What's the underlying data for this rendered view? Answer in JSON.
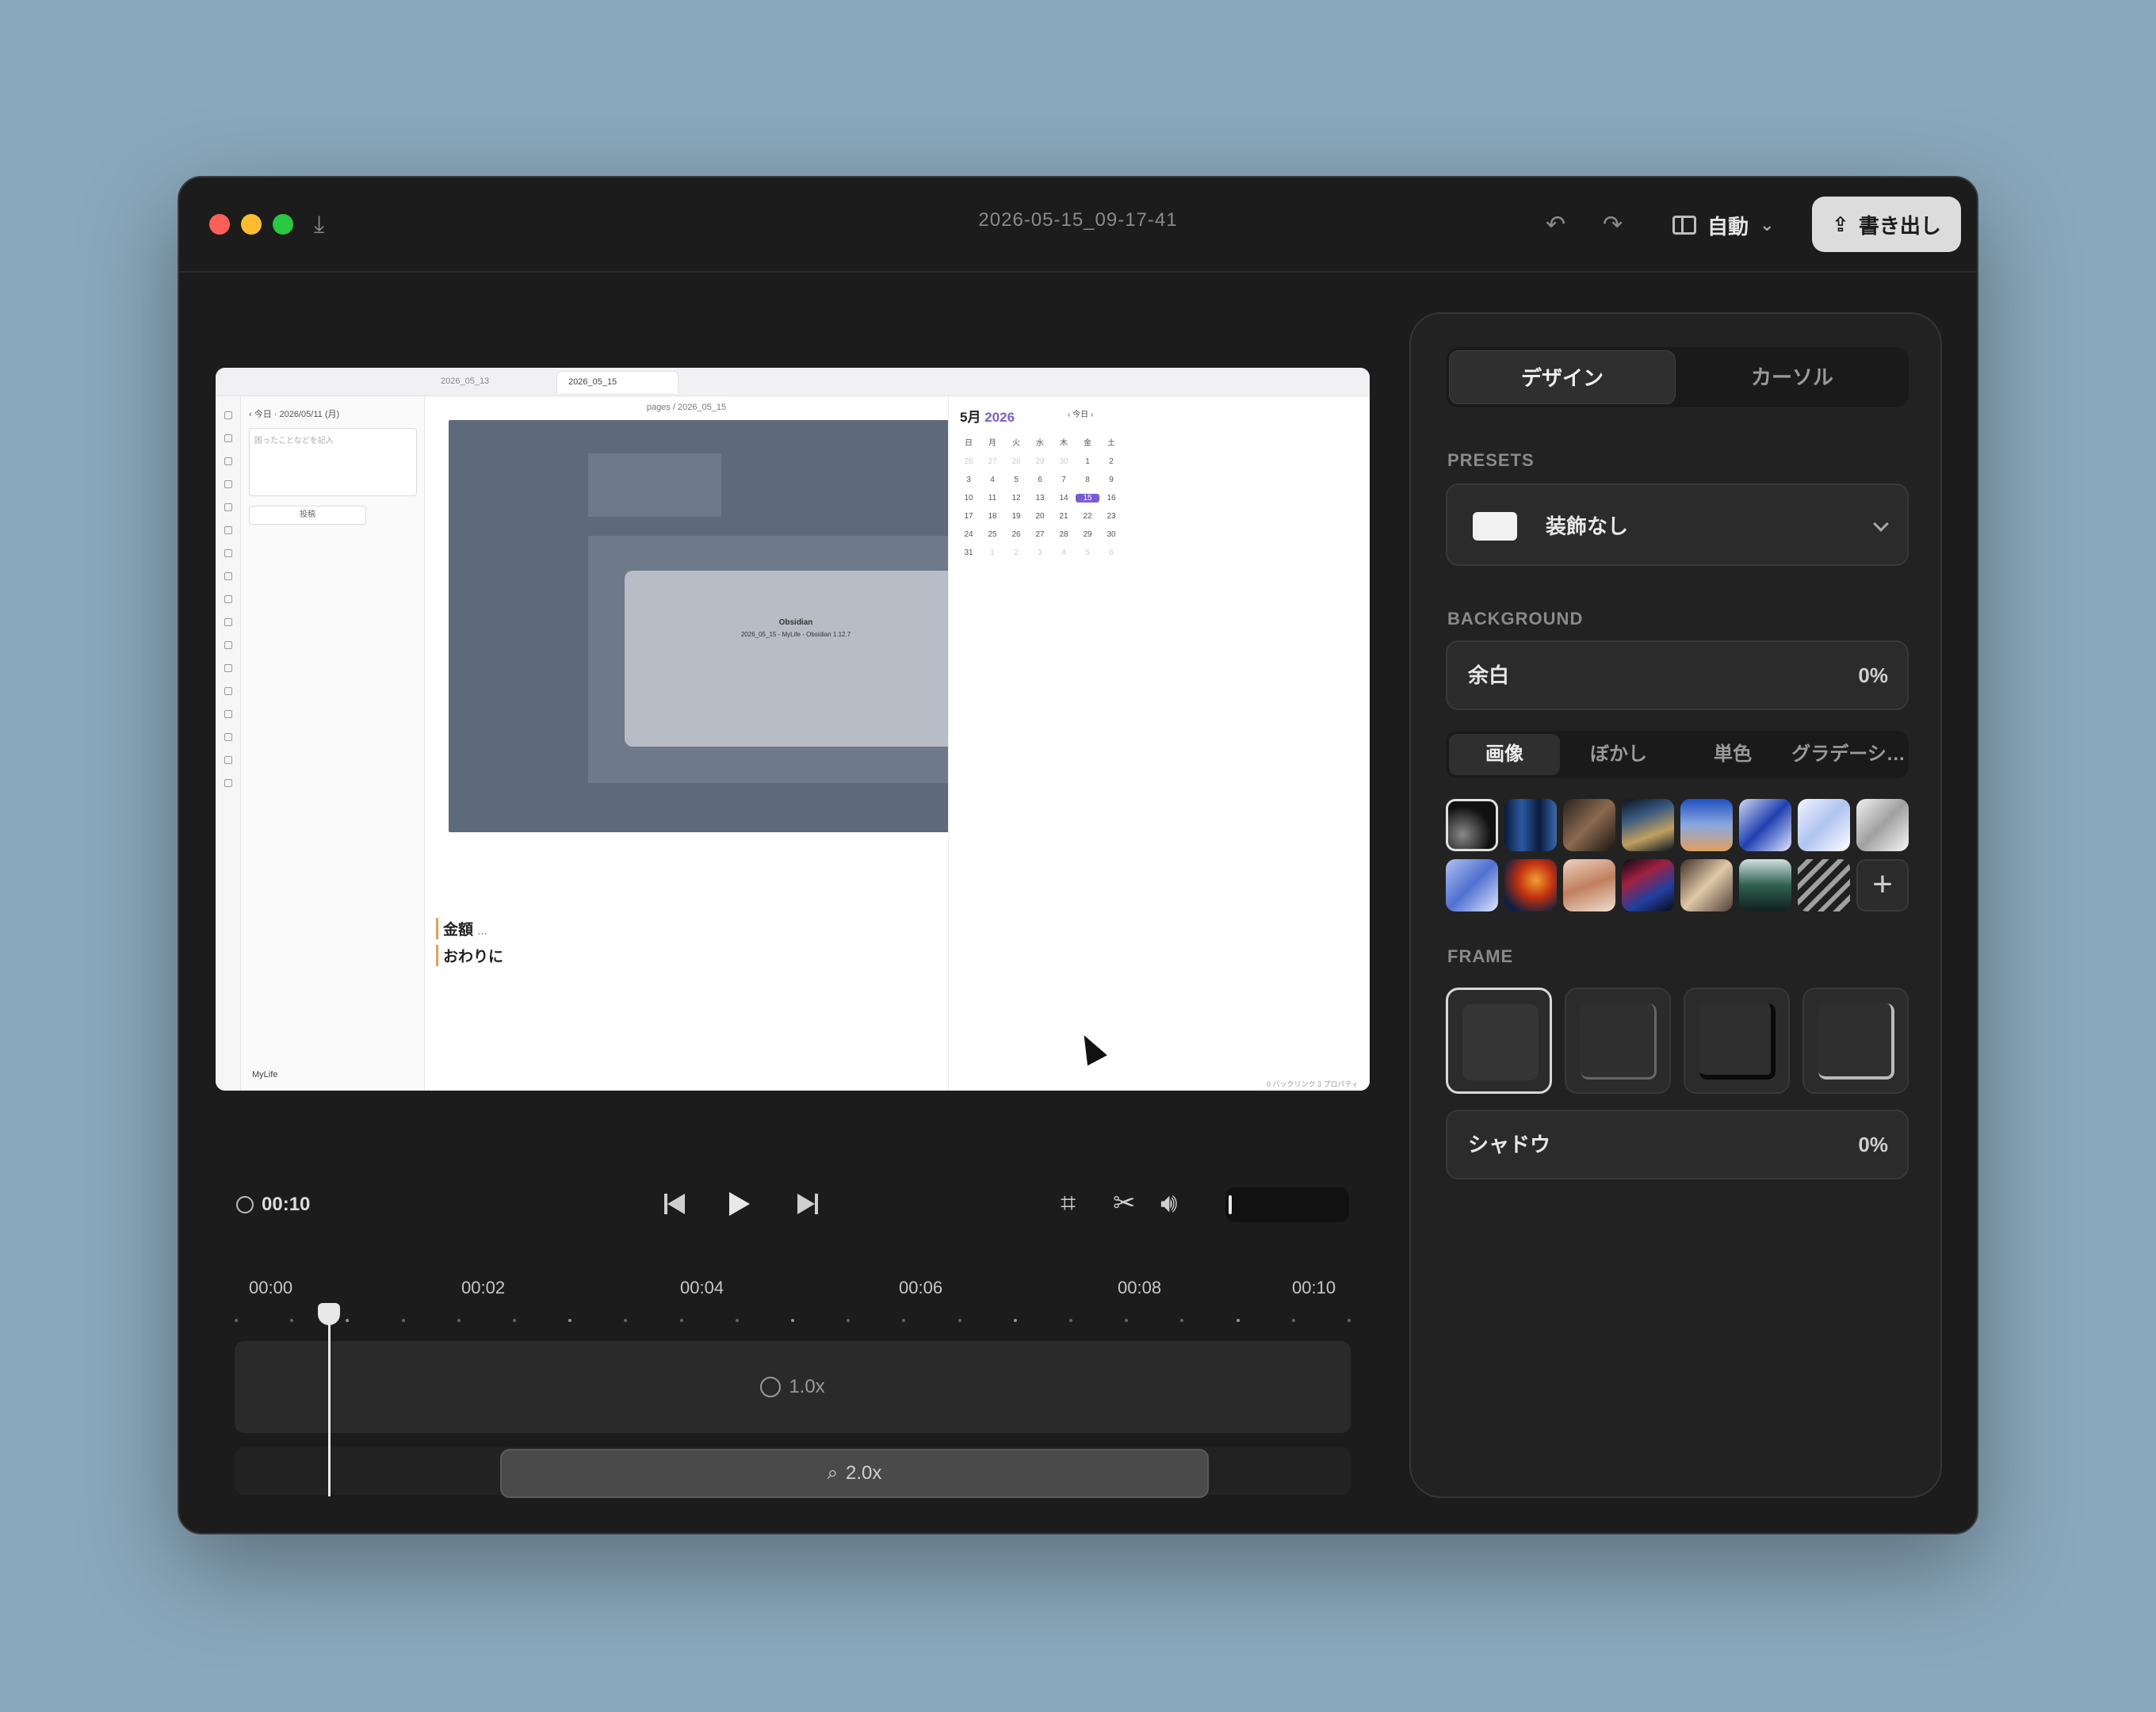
{
  "window": {
    "title": "2026-05-15_09-17-41",
    "layout_mode": "自動",
    "export_label": "書き出し"
  },
  "preview": {
    "tabs": [
      "2026_05_13",
      "2026_05_15"
    ],
    "date_nav": "2026/05/11",
    "weekday": "(月)",
    "today": "今日",
    "memo_placeholder": "困ったことなどを記入",
    "post_label": "投稿",
    "vault_name": "MyLife",
    "breadcrumb": "pages / 2026_05_15",
    "inner_app_name": "Obsidian",
    "inner_app_version": "2026_05_15 - MyLife - Obsidian 1.12.7",
    "heading_1": "金額",
    "heading_1_more": "...",
    "heading_2": "おわりに",
    "footer_status": "0 バックリンク  3 プロパティ",
    "calendar": {
      "month_label": "5月",
      "year_label": "2026",
      "today_btn": "今日",
      "weekdays": [
        "日",
        "月",
        "火",
        "水",
        "木",
        "金",
        "土"
      ],
      "days": [
        "26",
        "27",
        "28",
        "29",
        "30",
        "1",
        "2",
        "3",
        "4",
        "5",
        "6",
        "7",
        "8",
        "9",
        "10",
        "11",
        "12",
        "13",
        "14",
        "15",
        "16",
        "17",
        "18",
        "19",
        "20",
        "21",
        "22",
        "23",
        "24",
        "25",
        "26",
        "27",
        "28",
        "29",
        "30",
        "31",
        "1",
        "2",
        "3",
        "4",
        "5",
        "6"
      ],
      "selected": "15"
    }
  },
  "playback": {
    "duration": "00:10"
  },
  "timeline": {
    "ticks": [
      "00:00",
      "00:02",
      "00:04",
      "00:06",
      "00:08",
      "00:10"
    ],
    "speed_label": "1.0x",
    "zoom_label": "2.0x",
    "playhead_fraction": 0.084,
    "zoom_start_fraction": 0.238,
    "zoom_end_fraction": 0.873
  },
  "panel": {
    "tabs": [
      "デザイン",
      "カーソル"
    ],
    "presets_label": "PRESETS",
    "preset_value": "装飾なし",
    "background_label": "BACKGROUND",
    "padding_label": "余白",
    "padding_value": "0%",
    "bg_tabs": [
      "画像",
      "ぼかし",
      "単色",
      "グラデーシ…"
    ],
    "frame_label": "FRAME",
    "shadow_label": "シャドウ",
    "shadow_value": "0%"
  }
}
